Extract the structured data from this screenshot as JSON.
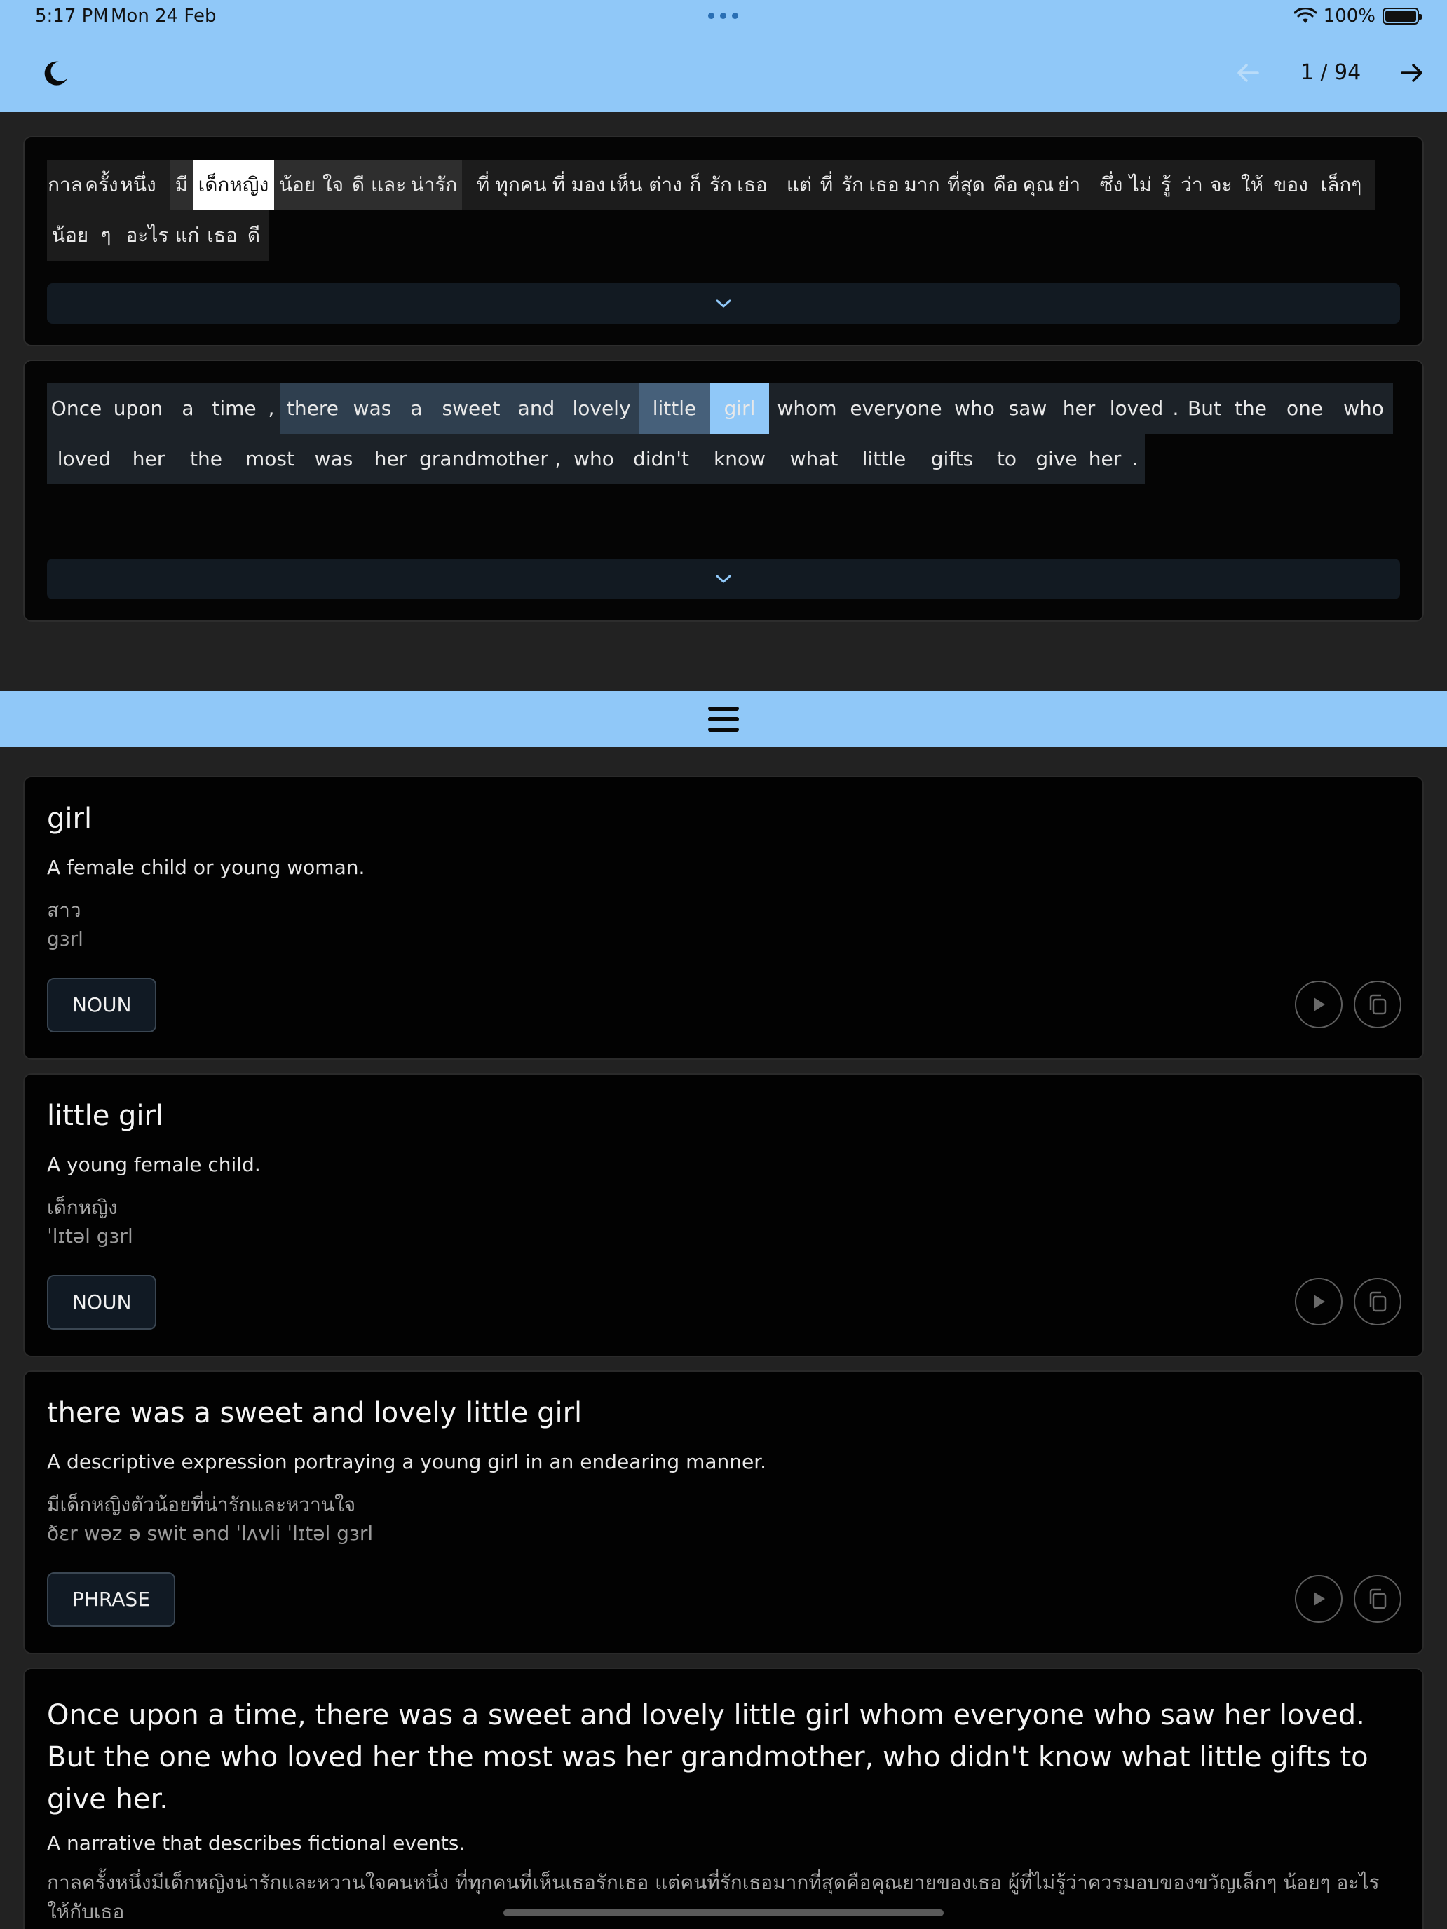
{
  "status": {
    "time": "5:17 PM",
    "date": "Mon 24 Feb",
    "battery": "100%",
    "battery_level": 1.0
  },
  "header": {
    "page_indicator": "1 / 94"
  },
  "thai_panel": {
    "tokens": [
      {
        "t": "กาล",
        "bg": "#1c1c1c",
        "w": 52
      },
      {
        "t": "ครั้ง",
        "bg": "#1c1c1c",
        "w": 52
      },
      {
        "t": "หนึ่ง",
        "bg": "#1c1c1c",
        "w": 52
      },
      {
        "t": "",
        "bg": "#1c1c1c",
        "w": 20
      },
      {
        "t": "มี",
        "bg": "#2e2e2e",
        "w": 32
      },
      {
        "t": "เด็กหญิง",
        "bg": "#ffffff",
        "fg": "#111111",
        "w": 116
      },
      {
        "t": "น้อย",
        "bg": "#2e2e2e",
        "w": 66
      },
      {
        "t": "ใจ",
        "bg": "#2e2e2e",
        "w": 36
      },
      {
        "t": "ดี",
        "bg": "#2e2e2e",
        "w": 36
      },
      {
        "t": "และ",
        "bg": "#2e2e2e",
        "w": 50
      },
      {
        "t": "น่ารัก",
        "bg": "#2e2e2e",
        "w": 80
      },
      {
        "t": "",
        "bg": "#1c1c1c",
        "w": 14
      },
      {
        "t": "ที่",
        "bg": "#1c1c1c",
        "w": 32
      },
      {
        "t": "ทุกคน",
        "bg": "#1c1c1c",
        "w": 76
      },
      {
        "t": "ที่",
        "bg": "#1c1c1c",
        "w": 32
      },
      {
        "t": "มอง",
        "bg": "#1c1c1c",
        "w": 52
      },
      {
        "t": "เห็น",
        "bg": "#1c1c1c",
        "w": 56
      },
      {
        "t": "ต่าง",
        "bg": "#1c1c1c",
        "w": 56
      },
      {
        "t": "ก็",
        "bg": "#1c1c1c",
        "w": 30
      },
      {
        "t": "รัก",
        "bg": "#1c1c1c",
        "w": 42
      },
      {
        "t": "เธอ",
        "bg": "#1c1c1c",
        "w": 48
      },
      {
        "t": "",
        "bg": "#1c1c1c",
        "w": 20
      },
      {
        "t": "แต่",
        "bg": "#1c1c1c",
        "w": 46
      },
      {
        "t": "ที่",
        "bg": "#1c1c1c",
        "w": 32
      },
      {
        "t": "รัก",
        "bg": "#1c1c1c",
        "w": 42
      },
      {
        "t": "เธอ",
        "bg": "#1c1c1c",
        "w": 48
      },
      {
        "t": "มาก",
        "bg": "#1c1c1c",
        "w": 60
      },
      {
        "t": "ที่สุด",
        "bg": "#1c1c1c",
        "w": 66
      },
      {
        "t": "คือ",
        "bg": "#1c1c1c",
        "w": 46
      },
      {
        "t": "คุณ",
        "bg": "#1c1c1c",
        "w": 48
      },
      {
        "t": "ย่า",
        "bg": "#1c1c1c",
        "w": 40
      },
      {
        "t": "",
        "bg": "#1c1c1c",
        "w": 18
      },
      {
        "t": "ซึ่ง",
        "bg": "#1c1c1c",
        "w": 44
      },
      {
        "t": "ไม่",
        "bg": "#1c1c1c",
        "w": 40
      },
      {
        "t": "รู้",
        "bg": "#1c1c1c",
        "w": 32
      },
      {
        "t": "ว่า",
        "bg": "#1c1c1c",
        "w": 42
      },
      {
        "t": "จะ",
        "bg": "#1c1c1c",
        "w": 42
      },
      {
        "t": "ให้",
        "bg": "#1c1c1c",
        "w": 46
      },
      {
        "t": "ของ",
        "bg": "#1c1c1c",
        "w": 64
      },
      {
        "t": "เล็กๆ",
        "bg": "#1c1c1c",
        "w": 80
      },
      {
        "t": "",
        "bg": "#1c1c1c",
        "w": 8
      },
      {
        "t": "น้อย",
        "bg": "#1c1c1c",
        "w": 66
      },
      {
        "t": "ๆ",
        "bg": "#1c1c1c",
        "w": 36
      },
      {
        "t": "",
        "bg": "#1c1c1c",
        "w": 10
      },
      {
        "t": "อะไร",
        "bg": "#1c1c1c",
        "w": 62
      },
      {
        "t": "แก่",
        "bg": "#1c1c1c",
        "w": 52
      },
      {
        "t": "เธอ",
        "bg": "#1c1c1c",
        "w": 48
      },
      {
        "t": "ดี",
        "bg": "#1c1c1c",
        "w": 42
      }
    ]
  },
  "english_panel": {
    "tokens": [
      {
        "t": "Once",
        "bg": "#1c2228",
        "w": 84
      },
      {
        "t": "upon",
        "bg": "#1c2228",
        "w": 92
      },
      {
        "t": "a",
        "bg": "#1c2228",
        "w": 50
      },
      {
        "t": "time",
        "bg": "#1c2228",
        "w": 82
      },
      {
        "t": ",",
        "bg": "#1c2228",
        "w": 24
      },
      {
        "t": "there",
        "bg": "#2f3f4f",
        "w": 94
      },
      {
        "t": "was",
        "bg": "#2f3f4f",
        "w": 76
      },
      {
        "t": "a",
        "bg": "#2f3f4f",
        "w": 50
      },
      {
        "t": "sweet",
        "bg": "#2f3f4f",
        "w": 106
      },
      {
        "t": "and",
        "bg": "#2f3f4f",
        "w": 80
      },
      {
        "t": "lovely",
        "bg": "#2f3f4f",
        "w": 106
      },
      {
        "t": "little",
        "bg": "#46607a",
        "w": 102
      },
      {
        "t": "girl",
        "bg": "#90c8f8",
        "w": 84
      },
      {
        "t": "whom",
        "bg": "#1c2228",
        "w": 108
      },
      {
        "t": "everyone",
        "bg": "#1c2228",
        "w": 146
      },
      {
        "t": "who",
        "bg": "#1c2228",
        "w": 78
      },
      {
        "t": "saw",
        "bg": "#1c2228",
        "w": 74
      },
      {
        "t": "her",
        "bg": "#1c2228",
        "w": 72
      },
      {
        "t": "loved",
        "bg": "#1c2228",
        "w": 92
      },
      {
        "t": ".",
        "bg": "#1c2228",
        "w": 20
      },
      {
        "t": "But",
        "bg": "#1c2228",
        "w": 62
      },
      {
        "t": "the",
        "bg": "#1c2228",
        "w": 70
      },
      {
        "t": "one",
        "bg": "#1c2228",
        "w": 84
      },
      {
        "t": "who",
        "bg": "#1c2228",
        "w": 84
      },
      {
        "t": "loved",
        "bg": "#1c2228",
        "w": 106
      },
      {
        "t": "her",
        "bg": "#1c2228",
        "w": 78
      },
      {
        "t": "the",
        "bg": "#1c2228",
        "w": 86
      },
      {
        "t": "most",
        "bg": "#1c2228",
        "w": 96
      },
      {
        "t": "was",
        "bg": "#1c2228",
        "w": 86
      },
      {
        "t": "her",
        "bg": "#1c2228",
        "w": 76
      },
      {
        "t": "grandmother",
        "bg": "#1c2228",
        "w": 190
      },
      {
        "t": ",",
        "bg": "#1c2228",
        "w": 22
      },
      {
        "t": "who",
        "bg": "#1c2228",
        "w": 80
      },
      {
        "t": "didn't",
        "bg": "#1c2228",
        "w": 112
      },
      {
        "t": "know",
        "bg": "#1c2228",
        "w": 112
      },
      {
        "t": "what",
        "bg": "#1c2228",
        "w": 100
      },
      {
        "t": "little",
        "bg": "#1c2228",
        "w": 100
      },
      {
        "t": "gifts",
        "bg": "#1c2228",
        "w": 94
      },
      {
        "t": "to",
        "bg": "#1c2228",
        "w": 62
      },
      {
        "t": "give",
        "bg": "#1c2228",
        "w": 80
      },
      {
        "t": "her",
        "bg": "#1c2228",
        "w": 58
      },
      {
        "t": ".",
        "bg": "#1c2228",
        "w": 28
      }
    ]
  },
  "cards": [
    {
      "title": "girl",
      "definition": "A female child or young woman.",
      "thai": "สาว",
      "ipa": "gɜrl",
      "pos": "NOUN"
    },
    {
      "title": "little girl",
      "definition": "A young female child.",
      "thai": "เด็กหญิง",
      "ipa": "ˈlɪtəl gɜrl",
      "pos": "NOUN"
    },
    {
      "title": "there was a sweet and lovely little girl",
      "definition": "A descriptive expression portraying a young girl in an endearing manner.",
      "thai": "มีเด็กหญิงตัวน้อยที่น่ารักและหวานใจ",
      "ipa": "ðɛr wəz ə swit ənd ˈlʌvli ˈlɪtəl gɜrl",
      "pos": "PHRASE"
    }
  ],
  "sentence_card": {
    "title": "Once upon a time, there was a sweet and lovely little girl whom everyone who saw her loved. But the one who loved her the most was her grandmother, who didn't know what little gifts to give her.",
    "definition": "A narrative that describes fictional events.",
    "thai": "กาลครั้งหนึ่งมีเด็กหญิงน่ารักและหวานใจคนหนึ่ง ที่ทุกคนที่เห็นเธอรักเธอ แต่คนที่รักเธอมากที่สุดคือคุณยายของเธอ ผู้ที่ไม่รู้ว่าควรมอบของขวัญเล็กๆ น้อยๆ อะไรให้กับเธอ"
  },
  "colors": {
    "accent": "#90c8f8",
    "background": "#222222",
    "panel": "#050505",
    "highlight": "#90c8f8"
  }
}
